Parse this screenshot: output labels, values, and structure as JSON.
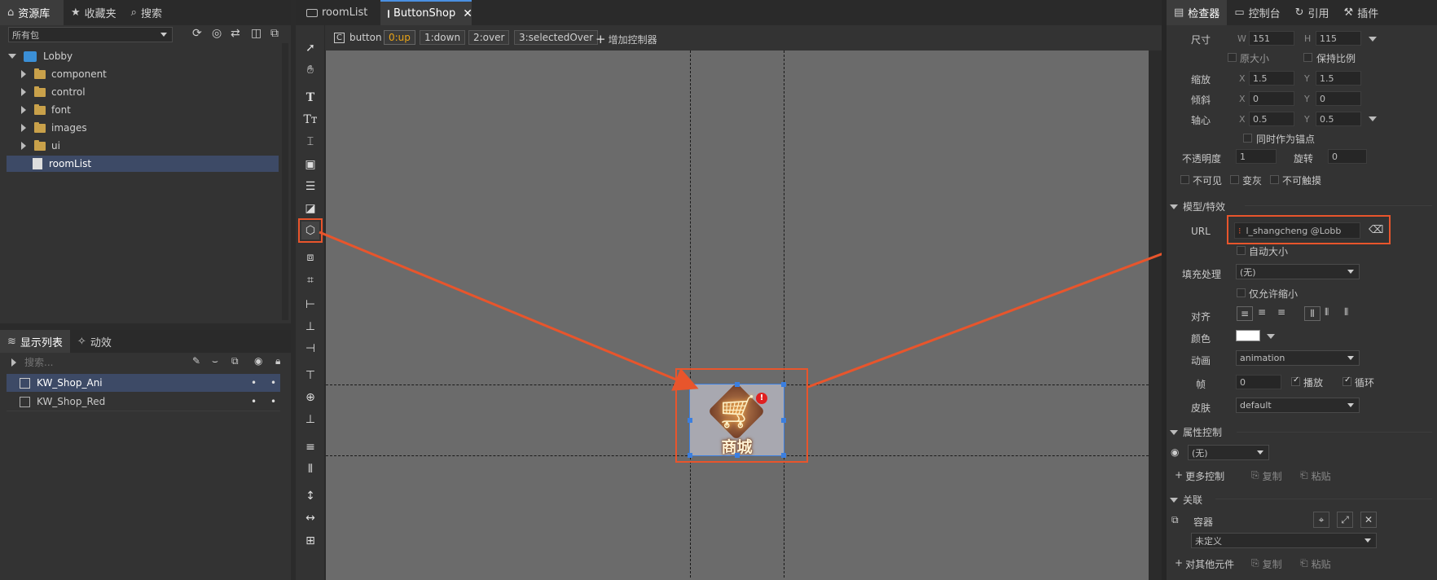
{
  "left": {
    "tabs": [
      {
        "label": "资源库",
        "icon": "library-icon"
      },
      {
        "label": "收藏夹",
        "icon": "star-icon"
      },
      {
        "label": "搜索",
        "icon": "search-icon"
      }
    ],
    "package_filter": "所有包",
    "tree": {
      "root": "Lobby",
      "folders": [
        "component",
        "control",
        "font",
        "images",
        "ui"
      ],
      "selected_file": "roomList"
    }
  },
  "display_list": {
    "tabs": [
      {
        "label": "显示列表",
        "icon": "layers-icon"
      },
      {
        "label": "动效",
        "icon": "magic-wand-icon"
      }
    ],
    "search_placeholder": "搜索...",
    "items": [
      {
        "name": "KW_Shop_Ani",
        "selected": true
      },
      {
        "name": "KW_Shop_Red",
        "selected": false
      }
    ]
  },
  "doc_tabs": [
    {
      "label": "roomList",
      "active": false
    },
    {
      "label": "ButtonShop",
      "active": true
    }
  ],
  "state_bar": {
    "component_icon": "C",
    "component_label": "button",
    "states": [
      "0:up",
      "1:down",
      "2:over",
      "3:selectedOver"
    ],
    "active_state": "0:up",
    "add_controller": "增加控制器"
  },
  "canvas": {
    "shop_label": "商城",
    "badge": "!"
  },
  "inspector": {
    "tabs": [
      {
        "label": "检查器",
        "icon": "inspector-icon"
      },
      {
        "label": "控制台",
        "icon": "console-icon"
      },
      {
        "label": "引用",
        "icon": "reference-icon"
      },
      {
        "label": "插件",
        "icon": "plugin-icon"
      }
    ],
    "size": {
      "label": "尺寸",
      "w_label": "W",
      "w": "151",
      "h_label": "H",
      "h": "115"
    },
    "original_size": "原大小",
    "keep_ratio": "保持比例",
    "scale": {
      "label": "缩放",
      "x_label": "X",
      "x": "1.5",
      "y_label": "Y",
      "y": "1.5"
    },
    "skew": {
      "label": "倾斜",
      "x_label": "X",
      "x": "0",
      "y_label": "Y",
      "y": "0"
    },
    "pivot": {
      "label": "轴心",
      "x_label": "X",
      "x": "0.5",
      "y_label": "Y",
      "y": "0.5"
    },
    "as_anchor": "同时作为锚点",
    "opacity": {
      "label": "不透明度",
      "value": "1"
    },
    "rotation": {
      "label": "旋转",
      "value": "0"
    },
    "invisible": "不可见",
    "grayed": "变灰",
    "untouchable": "不可触摸",
    "model_section": "模型/特效",
    "url_label": "URL",
    "url_value": "l_shangcheng @Lobb",
    "auto_size": "自动大小",
    "fill": {
      "label": "填充处理",
      "value": "(无)"
    },
    "shrink_only": "仅允许缩小",
    "align_label": "对齐",
    "color_label": "颜色",
    "color_value": "#ffffff",
    "animation": {
      "label": "动画",
      "value": "animation"
    },
    "frame": {
      "label": "帧",
      "value": "0",
      "play": "播放",
      "loop": "循环"
    },
    "skin": {
      "label": "皮肤",
      "value": "default"
    },
    "property_control": "属性控制",
    "prop_value": "(无)",
    "more_control": "更多控制",
    "copy": "复制",
    "paste": "粘贴",
    "relation": "关联",
    "container": "容器",
    "undefined": "未定义",
    "other_component": "对其他元件"
  },
  "colors": {
    "highlight": "#e8552c",
    "selection_blue": "#3b7fe0",
    "active_state": "#e8a317"
  }
}
